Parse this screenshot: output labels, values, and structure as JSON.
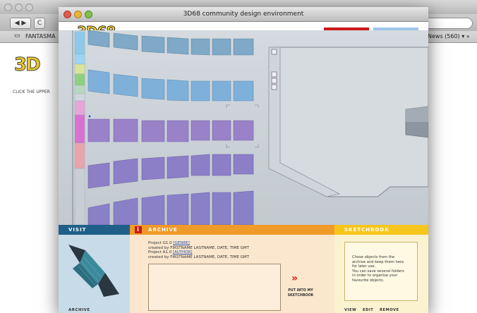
{
  "background_browser": {
    "bookmark_label": "FANTASMA",
    "news_label": "News (560)",
    "page_logo": "3D",
    "page_hint": "CLICK THE UPPER"
  },
  "window": {
    "title": "3D68 community design environment"
  },
  "header": {
    "logo": "3D68"
  },
  "panels": {
    "visit": {
      "title": "VISIT",
      "footer_label": "ARCHIVE"
    },
    "archive": {
      "title": "ARCHIVE",
      "info_icon": "i",
      "projects": [
        {
          "name": "Project G1.0",
          "tag": "[GENRE]",
          "credit": "created by FIRSTNAME LASTNAME, DATE, TIME GMT"
        },
        {
          "name": "Project A1.0",
          "tag": "[AUTHOR]",
          "credit": "created by FIRSTNAME LASTNAME, DATE, TIME GMT"
        }
      ],
      "put_label_line1": "PUT INTO MY",
      "put_label_line2": "SKETCHBOOK"
    },
    "sketchbook": {
      "title": "SKETCHBOOK",
      "description_lines": [
        "Chose objects from the",
        "archive and keep them here",
        "for later use.",
        "You can save several folders",
        "in order to organise your",
        "favourite objects."
      ],
      "buttons": [
        "VIEW",
        "EDIT",
        "REMOVE"
      ]
    }
  },
  "colors": {
    "visit_header": "#1f5f8a",
    "archive_header": "#f09a2a",
    "sketchbook_header": "#f7c61c",
    "accent_red": "#cc1919",
    "accent_blue": "#9cc4ea"
  }
}
